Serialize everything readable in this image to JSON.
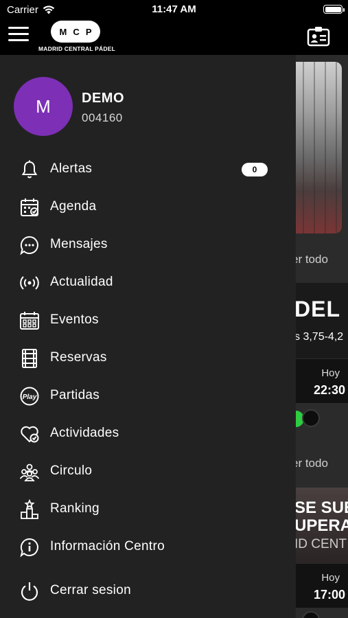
{
  "status_bar": {
    "carrier": "Carrier",
    "time": "11:47 AM",
    "battery_level": 1.0
  },
  "header": {
    "logo_letters": [
      "M",
      "C",
      "P"
    ],
    "logo_text": "MADRID CENTRAL PÁDEL",
    "menu_icon": "hamburger-icon",
    "card_icon": "member-card-icon"
  },
  "profile": {
    "initial": "M",
    "name": "DEMO",
    "id": "004160",
    "avatar_color": "#7d2fb5"
  },
  "menu": [
    {
      "label": "Alertas",
      "icon": "bell-icon",
      "badge": "0"
    },
    {
      "label": "Agenda",
      "icon": "calendar-check-icon"
    },
    {
      "label": "Mensajes",
      "icon": "chat-bubble-icon"
    },
    {
      "label": "Actualidad",
      "icon": "broadcast-icon"
    },
    {
      "label": "Eventos",
      "icon": "calendar-grid-icon"
    },
    {
      "label": "Reservas",
      "icon": "court-icon"
    },
    {
      "label": "Partidas",
      "icon": "play-icon"
    },
    {
      "label": "Actividades",
      "icon": "heart-check-icon"
    },
    {
      "label": "Circulo",
      "icon": "group-icon"
    },
    {
      "label": "Ranking",
      "icon": "podium-icon"
    },
    {
      "label": "Información Centro",
      "icon": "info-icon"
    },
    {
      "label": "Cerrar sesion",
      "icon": "power-icon"
    }
  ],
  "background": {
    "ver_todo_1": "er todo",
    "banner_1_big": "DEL",
    "banner_1_small": "s 3,75-4,2",
    "hoy_1_label": "Hoy",
    "hoy_1_time": "22:30",
    "ver_todo_2": "er todo",
    "banner_2_line1": "SE SUE",
    "banner_2_line2": "UPERA",
    "banner_2_line3": "ID CENT",
    "hoy_2_label": "Hoy",
    "hoy_2_time": "17:00"
  }
}
